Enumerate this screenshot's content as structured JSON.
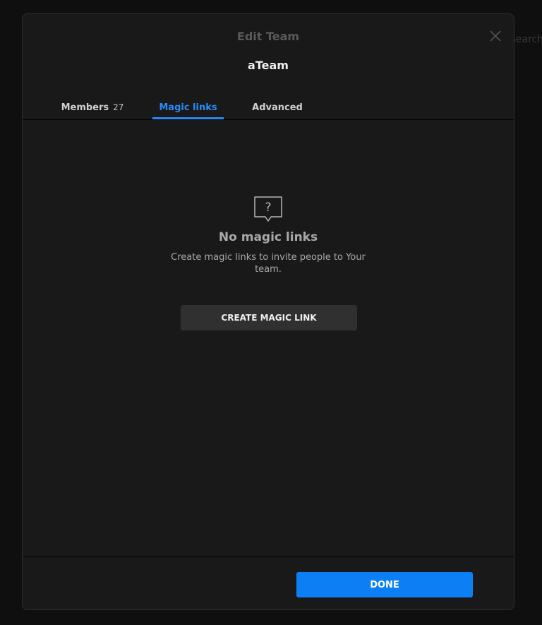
{
  "background": {
    "search_placeholder": "Search p"
  },
  "modal": {
    "title": "Edit Team",
    "team_name": "aTeam",
    "close_icon": "close-icon"
  },
  "tabs": [
    {
      "label": "Members",
      "count": "27",
      "active": false
    },
    {
      "label": "Magic links",
      "active": true
    },
    {
      "label": "Advanced",
      "active": false
    }
  ],
  "empty_state": {
    "icon": "question-bubble-icon",
    "title": "No magic links",
    "description": "Create magic links to invite people to Your team."
  },
  "actions": {
    "create_label": "CREATE MAGIC LINK",
    "done_label": "DONE"
  },
  "colors": {
    "accent": "#0d7ff5",
    "active_tab": "#2a8af6",
    "modal_bg": "#191919",
    "page_bg": "#0f0f0f"
  }
}
